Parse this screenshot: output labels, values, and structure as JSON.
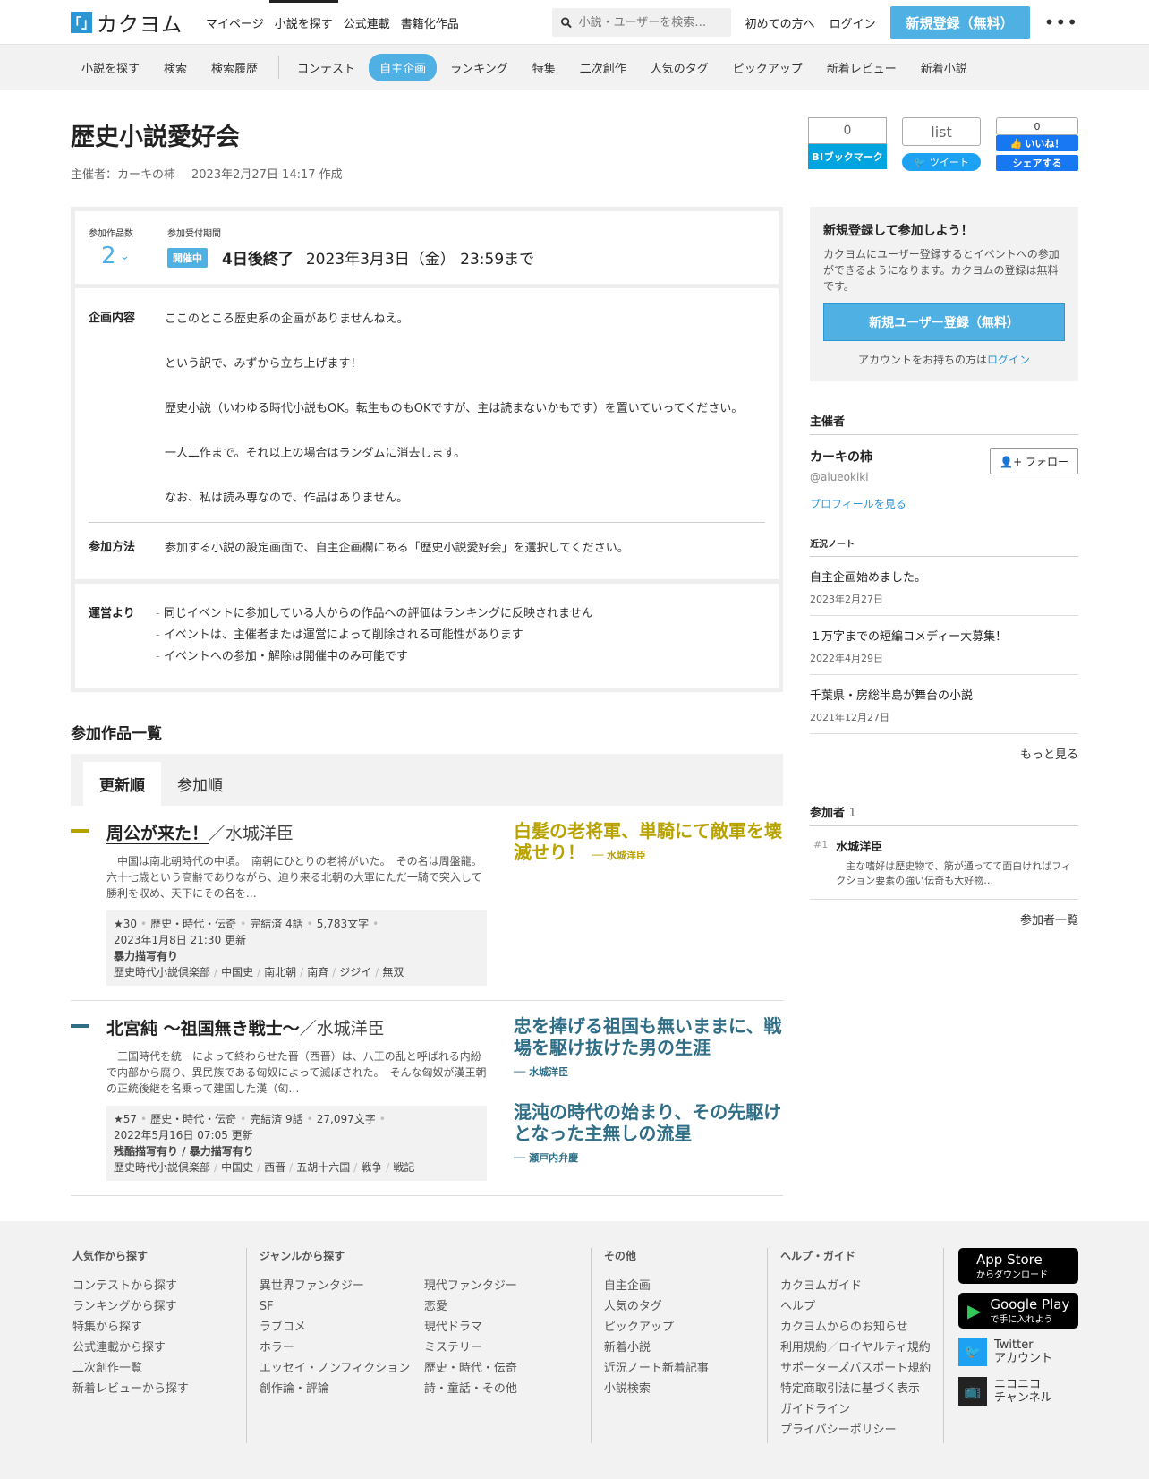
{
  "header": {
    "logo_mark": "「」",
    "logo_text": "カクヨム",
    "nav": [
      "マイページ",
      "小説を探す",
      "公式連載",
      "書籍化作品"
    ],
    "search_placeholder": "小説・ユーザーを検索…",
    "first_time": "初めての方へ",
    "login": "ログイン",
    "register": "新規登録（無料）",
    "more": "•••"
  },
  "subnav": [
    "小説を探す",
    "検索",
    "検索履歴",
    "コンテスト",
    "自主企画",
    "ランキング",
    "特集",
    "二次創作",
    "人気のタグ",
    "ピックアップ",
    "新着レビュー",
    "新着小説"
  ],
  "event": {
    "title": "歴史小説愛好会",
    "host_label": "主催者：カーキの柿",
    "created": "2023年2月27日 14:17 作成",
    "social": {
      "hatena_count": "0",
      "hatena_label": "B!ブックマーク",
      "tweet_count": "list",
      "tweet_label": "ツイート",
      "fb_count": "0",
      "fb_like": "いいね！",
      "fb_share": "シェアする"
    },
    "count_label": "参加作品数",
    "count": "2",
    "period_label": "参加受付期間",
    "status": "開催中",
    "remaining": "4日後終了",
    "deadline": "2023年3月3日（金） 23:59まで",
    "content_label": "企画内容",
    "content": [
      "ここのところ歴史系の企画がありませんねえ。",
      "という訳で、みずから立ち上げます！",
      "歴史小説（いわゆる時代小説もOK。転生ものもOKですが、主は読まないかもです）を置いていってください。",
      "一人二作まで。それ以上の場合はランダムに消去します。",
      "なお、私は読み専なので、作品はありません。"
    ],
    "method_label": "参加方法",
    "method": "参加する小説の設定画面で、自主企画欄にある「歴史小説愛好会」を選択してください。",
    "admin_label": "運営より",
    "admin_notes": [
      "同じイベントに参加している人からの作品への評価はランキングに反映されません",
      "イベントは、主催者または運営によって削除される可能性があります",
      "イベントへの参加・解除は開催中のみ可能です"
    ]
  },
  "works_section": {
    "title": "参加作品一覧",
    "tabs": [
      "更新順",
      "参加順"
    ],
    "works": [
      {
        "title": "周公が来た！",
        "author": "水城洋臣",
        "color": "#b8a200",
        "intro": "　中国は南北朝時代の中頃。　南朝にひとりの老将がいた。　その名は周盤龍。　六十七歳という高齢でありながら、迫り来る北朝の大軍にただ一騎で突入して勝利を収め、天下にその名を…",
        "stars": "★30",
        "genre": "歴史・時代・伝奇",
        "status": "完結済 4話",
        "chars": "5,783文字",
        "updated": "2023年1月8日 21:30 更新",
        "warn": "暴力描写有り",
        "tags": [
          "歴史時代小説倶楽部",
          "中国史",
          "南北朝",
          "南斉",
          "ジジイ",
          "無双"
        ],
        "catches": [
          {
            "text": "白髪の老将軍、単騎にて敵軍を壊滅せり！",
            "by": "── 水城洋臣"
          }
        ]
      },
      {
        "title": "北宮純 ～祖国無き戦士～",
        "author": "水城洋臣",
        "color": "#2f6e86",
        "intro": "　三国時代を統一によって終わらせた晋（西晋）は、八王の乱と呼ばれる内紛で内部から腐り、異民族である匈奴によって滅ぼされた。　そんな匈奴が漢王朝の正統後継を名乗って建国した漢（匈…",
        "stars": "★57",
        "genre": "歴史・時代・伝奇",
        "status": "完結済 9話",
        "chars": "27,097文字",
        "updated": "2022年5月16日 07:05 更新",
        "warn": "残酷描写有り / 暴力描写有り",
        "tags": [
          "歴史時代小説倶楽部",
          "中国史",
          "西晋",
          "五胡十六国",
          "戦争",
          "戦記"
        ],
        "catches": [
          {
            "text": "忠を捧げる祖国も無いままに、戦場を駆け抜けた男の生涯",
            "by": "── 水城洋臣"
          },
          {
            "text": "混沌の時代の始まり、その先駆けとなった主無しの流星",
            "by": "── 瀬戸内弁慶"
          }
        ]
      }
    ]
  },
  "sidebar": {
    "join_title": "新規登録して参加しよう！",
    "join_text": "カクヨムにユーザー登録するとイベントへの参加ができるようになります。カクヨムの登録は無料です。",
    "join_button": "新規ユーザー登録（無料）",
    "join_login_prefix": "アカウントをお持ちの方は",
    "join_login_link": "ログイン",
    "host_heading": "主催者",
    "host_name": "カーキの柿",
    "host_id": "@aiueokiki",
    "follow": "フォロー",
    "profile_link": "プロフィールを見る",
    "notes_heading": "近況ノート",
    "notes": [
      {
        "title": "自主企画始めました。",
        "date": "2023年2月27日"
      },
      {
        "title": "１万字までの短編コメディー大募集！",
        "date": "2022年4月29日"
      },
      {
        "title": "千葉県・房総半島が舞台の小説",
        "date": "2021年12月27日"
      }
    ],
    "notes_more": "もっと見る",
    "participants_heading": "参加者",
    "participants_count": "1",
    "participants": [
      {
        "no": "#1",
        "name": "水城洋臣",
        "desc": "　主な嗜好は歴史物で、筋が通ってて面白ければフィクション要素の強い伝奇も大好物…"
      }
    ],
    "participants_more": "参加者一覧"
  },
  "footer": {
    "popular": {
      "heading": "人気作から探す",
      "items": [
        "コンテストから探す",
        "ランキングから探す",
        "特集から探す",
        "公式連載から探す",
        "二次創作一覧",
        "新着レビューから探す"
      ]
    },
    "genre": {
      "heading": "ジャンルから探す",
      "col1": [
        "異世界ファンタジー",
        "SF",
        "ラブコメ",
        "ホラー",
        "エッセイ・ノンフィクション",
        "創作論・評論"
      ],
      "col2": [
        "現代ファンタジー",
        "恋愛",
        "現代ドラマ",
        "ミステリー",
        "歴史・時代・伝奇",
        "詩・童話・その他"
      ]
    },
    "other": {
      "heading": "その他",
      "items": [
        "自主企画",
        "人気のタグ",
        "ピックアップ",
        "新着小説",
        "近況ノート新着記事",
        "小説検索"
      ]
    },
    "help": {
      "heading": "ヘルプ・ガイド",
      "items": [
        "カクヨムガイド",
        "ヘルプ",
        "カクヨムからのお知らせ",
        "利用規約",
        "ロイヤルティ規約",
        "サポーターズパスポート規約",
        "特定商取引法に基づく表示",
        "ガイドライン",
        "プライバシーポリシー"
      ]
    },
    "apps": {
      "appstore_l1": "App Store",
      "appstore_l2": "からダウンロード",
      "google_l1": "Google Play",
      "google_l2": "で手に入れよう",
      "twitter_l1": "Twitter",
      "twitter_l2": "アカウント",
      "nico_l1": "ニコニコ",
      "nico_l2": "チャンネル"
    }
  }
}
